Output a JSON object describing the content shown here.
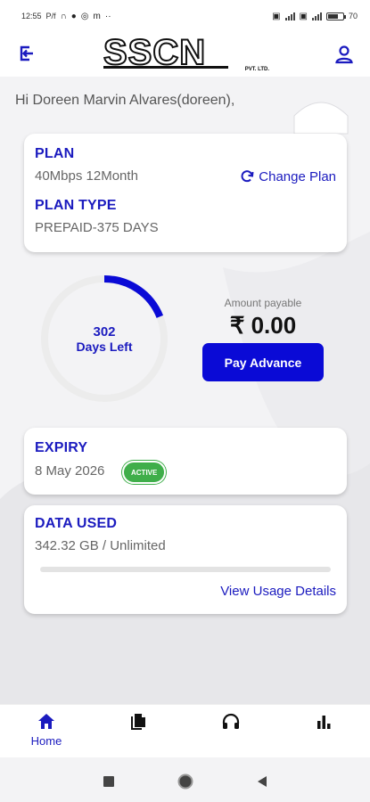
{
  "status_bar": {
    "time": "12:55",
    "carrier": "P/f",
    "battery": "70"
  },
  "header": {
    "logo_text": "SSCN",
    "logo_sub": "PVT. LTD."
  },
  "greeting": "Hi Doreen Marvin Alvares(doreen),",
  "plan": {
    "title": "PLAN",
    "value": "40Mbps 12Month",
    "change_label": "Change Plan",
    "type_title": "PLAN TYPE",
    "type_value": "PREPAID-375 DAYS"
  },
  "days": {
    "count": "302",
    "label": "Days Left",
    "progress_fraction": 0.19
  },
  "payment": {
    "label": "Amount payable",
    "amount": "₹ 0.00",
    "button": "Pay Advance"
  },
  "expiry": {
    "title": "EXPIRY",
    "date": "8 May 2026",
    "status": "ACTIVE"
  },
  "data_used": {
    "title": "DATA USED",
    "value": "342.32 GB / Unlimited",
    "fill_fraction": 0,
    "link": "View Usage Details"
  },
  "bottom_nav": {
    "home": "Home",
    "items": [
      "home-icon",
      "documents-icon",
      "headphones-icon",
      "bar-chart-icon"
    ]
  },
  "colors": {
    "accent": "#1b1bbf",
    "button": "#0a0ad6",
    "active": "#3fae4a"
  }
}
